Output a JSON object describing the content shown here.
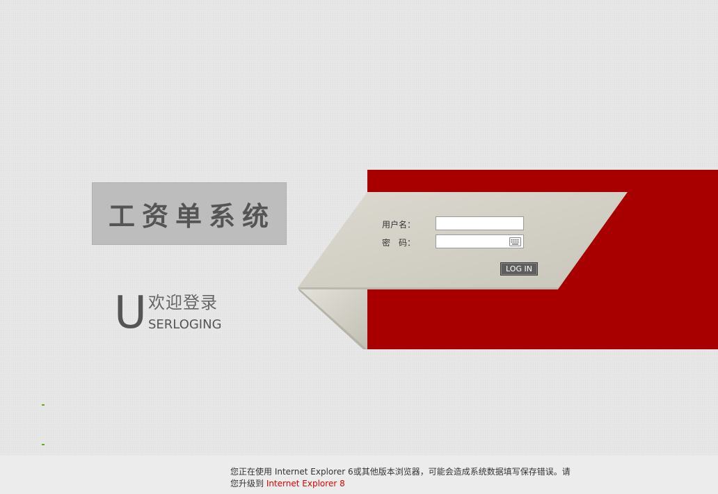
{
  "app": {
    "title": "工资单系统"
  },
  "welcome": {
    "big_letter": "U",
    "chinese": "欢迎登录",
    "english": "SERLOGING"
  },
  "form": {
    "username_label": "用户名：",
    "password_label": "密　码：",
    "username_value": "",
    "password_value": "",
    "login_label": "LOG IN"
  },
  "footer": {
    "line1": "您正在使用 Internet Explorer 6或其他版本浏览器，可能会造成系统数据填写保存错误。请",
    "line2_prefix": "您升级到 ",
    "link_text": "Internet Explorer 8"
  },
  "colors": {
    "accent_red": "#a80000",
    "panel_gray": "#d3d0c6",
    "title_box": "#bdbdbd"
  }
}
